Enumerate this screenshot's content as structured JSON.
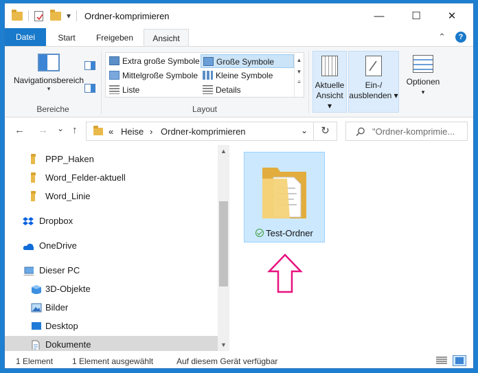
{
  "window": {
    "title": "Ordner-komprimieren",
    "minimize_glyph": "—",
    "maximize_glyph": "☐",
    "close_glyph": "✕"
  },
  "quick_access": {
    "dropdown_glyph": "▾"
  },
  "ribbon_tabs": [
    {
      "label": "Datei"
    },
    {
      "label": "Start"
    },
    {
      "label": "Freigeben"
    },
    {
      "label": "Ansicht"
    }
  ],
  "ribbon_extras": {
    "collapse_glyph": "⌃",
    "help_glyph": "?"
  },
  "ribbon": {
    "bereiche": {
      "label": "Bereiche",
      "nav_button": "Navigationsbereich",
      "nav_dropdown": "▾"
    },
    "layout": {
      "label": "Layout",
      "items": [
        {
          "label": "Extra große Symbole"
        },
        {
          "label": "Große Symbole"
        },
        {
          "label": "Mittelgroße Symbole"
        },
        {
          "label": "Kleine Symbole"
        },
        {
          "label": "Liste"
        },
        {
          "label": "Details"
        }
      ],
      "selected": "Große Symbole"
    },
    "aktuelle_ansicht": {
      "line1": "Aktuelle",
      "line2": "Ansicht ▾"
    },
    "ein_ausblenden": {
      "line1": "Ein-/",
      "line2": "ausblenden ▾"
    },
    "optionen": {
      "line1": "Optionen",
      "line2": "▾"
    }
  },
  "address_bar": {
    "back": "←",
    "forward": "→",
    "recent": "⌄",
    "up": "↑",
    "overflow": "«",
    "crumbs": [
      "Heise",
      "Ordner-komprimieren"
    ],
    "separator": "›",
    "dropdown": "⌄",
    "refresh": "↻"
  },
  "search": {
    "placeholder": "\"Ordner-komprimie..."
  },
  "nav_pane": {
    "items": [
      {
        "label": "PPP_Haken",
        "icon": "folder-icon"
      },
      {
        "label": "Word_Felder-aktuell",
        "icon": "folder-icon"
      },
      {
        "label": "Word_Linie",
        "icon": "folder-icon"
      },
      {
        "label": "Dropbox",
        "icon": "dropbox-icon"
      },
      {
        "label": "OneDrive",
        "icon": "onedrive-icon"
      },
      {
        "label": "Dieser PC",
        "icon": "computer-icon"
      },
      {
        "label": "3D-Objekte",
        "icon": "3d-objects-icon"
      },
      {
        "label": "Bilder",
        "icon": "pictures-icon"
      },
      {
        "label": "Desktop",
        "icon": "desktop-icon"
      },
      {
        "label": "Dokumente",
        "icon": "documents-icon"
      }
    ],
    "selected": "Dokumente",
    "scroll_up": "▲",
    "scroll_down": "▼"
  },
  "content": {
    "items": [
      {
        "label": "Test-Ordner",
        "icon": "folder-icon",
        "status": "synced-check-icon"
      }
    ],
    "annotation_color": "#e8117f"
  },
  "status_bar": {
    "count": "1 Element",
    "selection": "1 Element ausgewählt",
    "availability": "Auf diesem Gerät verfügbar"
  }
}
